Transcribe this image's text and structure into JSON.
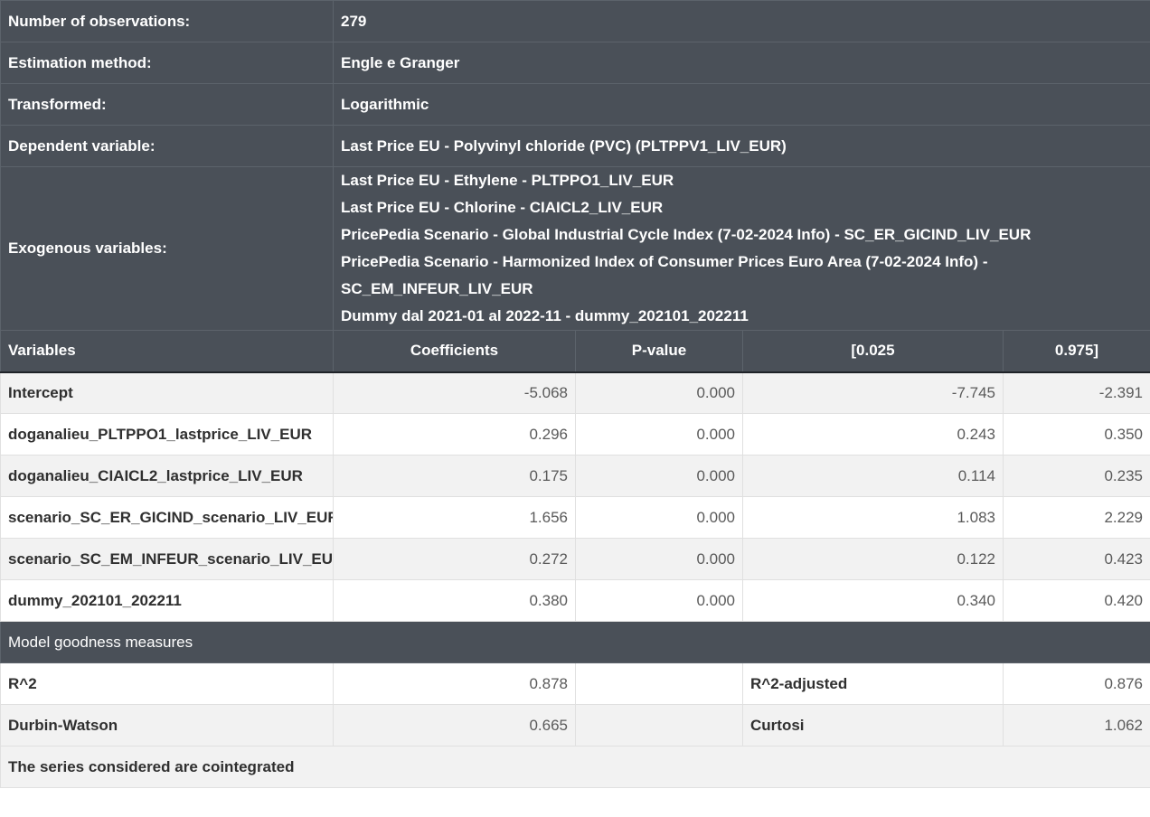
{
  "summary": {
    "observations_label": "Number of observations:",
    "observations_value": "279",
    "method_label": "Estimation method:",
    "method_value": "Engle e Granger",
    "transformed_label": "Transformed:",
    "transformed_value": "Logarithmic",
    "dependent_label": "Dependent variable:",
    "dependent_value": "Last Price EU - Polyvinyl chloride (PVC) (PLTPPV1_LIV_EUR)",
    "exogenous_label": "Exogenous variables:",
    "exogenous_lines": [
      "Last Price EU - Ethylene - PLTPPO1_LIV_EUR",
      "Last Price EU - Chlorine - CIAICL2_LIV_EUR",
      "PricePedia Scenario - Global Industrial Cycle Index (7-02-2024 Info) - SC_ER_GICIND_LIV_EUR",
      "PricePedia Scenario - Harmonized Index of Consumer Prices Euro Area (7-02-2024 Info) -",
      "SC_EM_INFEUR_LIV_EUR",
      "Dummy dal 2021-01 al 2022-11 - dummy_202101_202211"
    ]
  },
  "columns": {
    "variables": "Variables",
    "coefficients": "Coefficients",
    "pvalue": "P-value",
    "lower": "[0.025",
    "upper": "0.975]"
  },
  "rows": [
    {
      "name": "Intercept",
      "coef": "-5.068",
      "p": "0.000",
      "lo": "-7.745",
      "hi": "-2.391"
    },
    {
      "name": "doganalieu_PLTPPO1_lastprice_LIV_EUR",
      "coef": "0.296",
      "p": "0.000",
      "lo": "0.243",
      "hi": "0.350"
    },
    {
      "name": "doganalieu_CIAICL2_lastprice_LIV_EUR",
      "coef": "0.175",
      "p": "0.000",
      "lo": "0.114",
      "hi": "0.235"
    },
    {
      "name": "scenario_SC_ER_GICIND_scenario_LIV_EUR",
      "coef": "1.656",
      "p": "0.000",
      "lo": "1.083",
      "hi": "2.229"
    },
    {
      "name": "scenario_SC_EM_INFEUR_scenario_LIV_EUR",
      "coef": "0.272",
      "p": "0.000",
      "lo": "0.122",
      "hi": "0.423"
    },
    {
      "name": "dummy_202101_202211",
      "coef": "0.380",
      "p": "0.000",
      "lo": "0.340",
      "hi": "0.420"
    }
  ],
  "goodness": {
    "title": "Model goodness measures",
    "r2_label": "R^2",
    "r2_value": "0.878",
    "r2adj_label": "R^2-adjusted",
    "r2adj_value": "0.876",
    "dw_label": "Durbin-Watson",
    "dw_value": "0.665",
    "kurt_label": "Curtosi",
    "kurt_value": "1.062"
  },
  "conclusion": "The series considered are cointegrated"
}
